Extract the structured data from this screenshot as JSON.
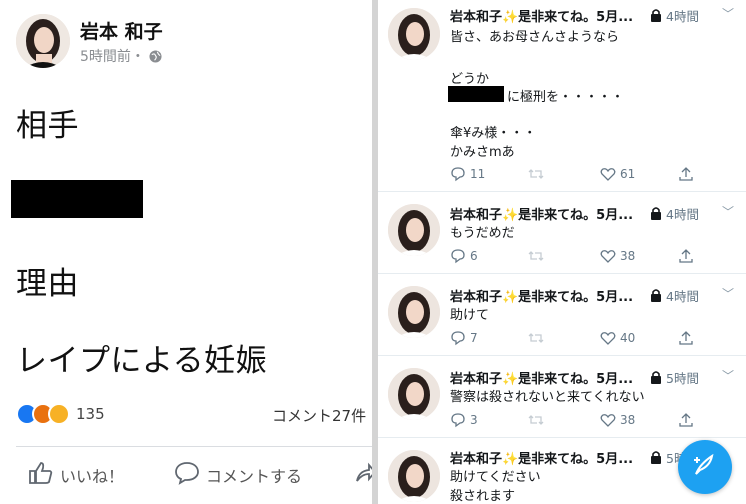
{
  "facebook_post": {
    "author_name": "岩本 和子",
    "time": "5時間前・",
    "lines": [
      "相手",
      "理由",
      "レイプによる妊娠"
    ],
    "reaction_count": "135",
    "comment_count": "コメント27件",
    "like_label": "いいね！",
    "comment_label": "コメントする"
  },
  "timeline": {
    "tweets": [
      {
        "name": "岩本和子✨是非来てね。5月...",
        "time": "4時間",
        "lines": [
          "皆さ、あお母さんさようなら",
          "",
          "どうか",
          "に極刑を・・・・・",
          "",
          "傘¥み様・・・",
          "かみさmあ"
        ],
        "replies": "11",
        "retweets": "",
        "likes": "61"
      },
      {
        "name": "岩本和子✨是非来てね。5月...",
        "time": "4時間",
        "lines": [
          "もうだめだ"
        ],
        "replies": "6",
        "retweets": "",
        "likes": "38"
      },
      {
        "name": "岩本和子✨是非来てね。5月...",
        "time": "4時間",
        "lines": [
          "助けて"
        ],
        "replies": "7",
        "retweets": "",
        "likes": "40"
      },
      {
        "name": "岩本和子✨是非来てね。5月...",
        "time": "5時間",
        "lines": [
          "警察は殺されないと来てくれない"
        ],
        "replies": "3",
        "retweets": "",
        "likes": "38"
      },
      {
        "name": "岩本和子✨是非来てね。5月...",
        "time": "5時間",
        "lines": [
          "助けてください",
          "殺されます"
        ],
        "replies": "",
        "retweets": "",
        "likes": ""
      }
    ]
  },
  "colors": {
    "accent": "#1da1f2",
    "like_blue": "#1877f2",
    "angry": "#e9710f",
    "sad": "#f7b125"
  },
  "icons": [
    "globe-icon",
    "like-thumb-icon",
    "comment-icon",
    "share-icon",
    "lock-icon",
    "reply-icon",
    "retweet-icon",
    "heart-icon",
    "upload-icon",
    "compose-tweet-icon",
    "chevron-down-icon"
  ]
}
